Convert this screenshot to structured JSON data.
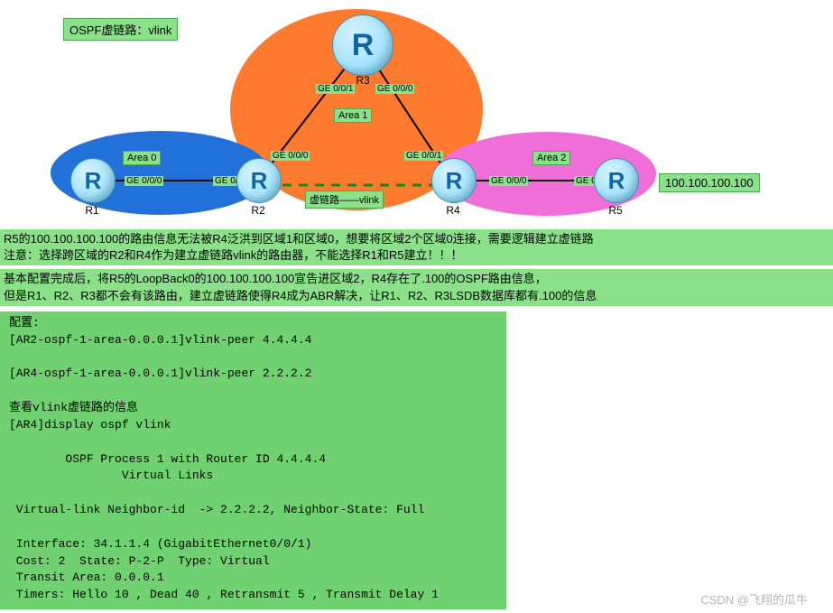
{
  "title": "OSPF虚链路：vlink",
  "areas": {
    "a0": "Area 0",
    "a1": "Area 1",
    "a2": "Area 2"
  },
  "routers": {
    "r1": "R1",
    "r2": "R2",
    "r3": "R3",
    "r4": "R4",
    "r5": "R5",
    "glyph": "R"
  },
  "ports": {
    "r1_e": "GE 0/0/0",
    "r2_w": "GE 0/0/1",
    "r2_ne": "GE 0/0/0",
    "r3_sw": "GE 0/0/1",
    "r3_se": "GE 0/0/0",
    "r4_nw": "GE 0/0/1",
    "r4_e": "GE 0/0/0",
    "r5_w": "GE 0/0/1"
  },
  "vlink_label": "虚链路——vlink",
  "loopback": "100.100.100.100",
  "note1_line1": "R5的100.100.100.100的路由信息无法被R4泛洪到区域1和区域0，想要将区域2个区域0连接，需要逻辑建立虚链路",
  "note1_line2": "注意：选择跨区域的R2和R4作为建立虚链路vlink的路由器，不能选择R1和R5建立！！！",
  "note2_line1": "基本配置完成后，将R5的LoopBack0的100.100.100.100宣告进区域2，R4存在了.100的OSPF路由信息，",
  "note2_line2": "但是R1、R2、R3都不会有该路由，建立虚链路使得R4成为ABR解决，让R1、R2、R3LSDB数据库都有.100的信息",
  "config": "配置:\n[AR2-ospf-1-area-0.0.0.1]vlink-peer 4.4.4.4\n\n[AR4-ospf-1-area-0.0.0.1]vlink-peer 2.2.2.2\n\n查看vlink虚链路的信息\n[AR4]display ospf vlink\n\n        OSPF Process 1 with Router ID 4.4.4.4\n                Virtual Links\n\n Virtual-link Neighbor-id  -> 2.2.2.2, Neighbor-State: Full\n\n Interface: 34.1.1.4 (GigabitEthernet0/0/1)\n Cost: 2  State: P-2-P  Type: Virtual\n Transit Area: 0.0.0.1\n Timers: Hello 10 , Dead 40 , Retransmit 5 , Transmit Delay 1",
  "watermark": "CSDN @飞翔的瓜牛"
}
